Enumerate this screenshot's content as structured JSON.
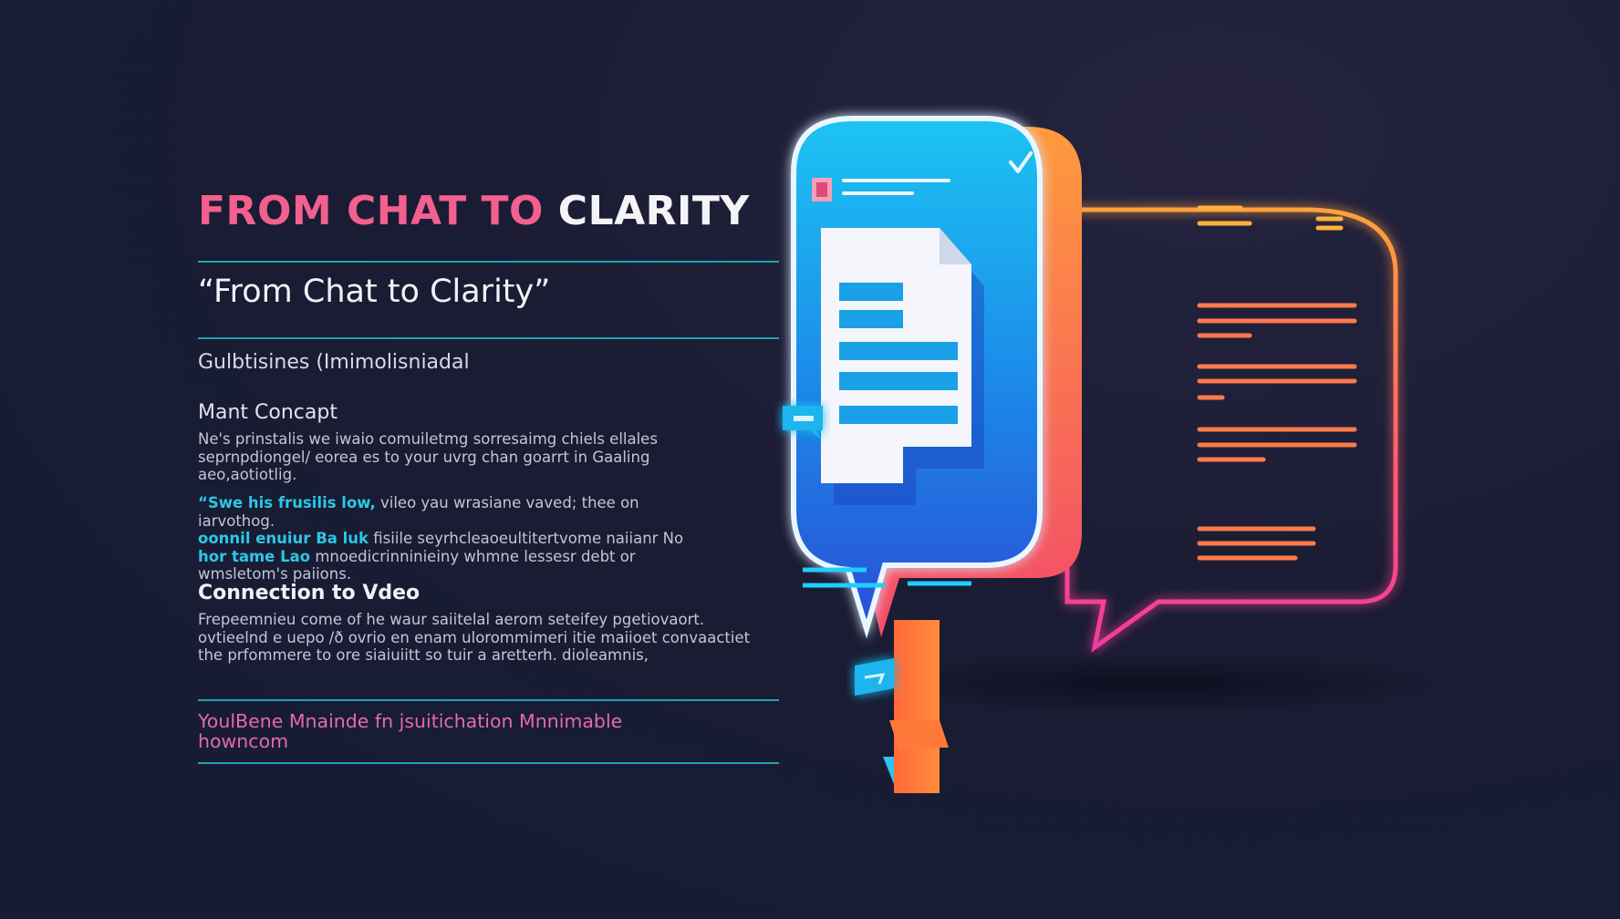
{
  "title": {
    "part_pink": "FROM CHAT TO",
    "part_white": "CLARITY"
  },
  "quote": "“From Chat to Clarity”",
  "subtitle": "Gulbtisines (Imimolisniadal",
  "main_concept": {
    "heading": "Mant Concapt",
    "body": "Ne's prinstalis we iwaio comuiletmg sorresaimg chiels ellales seprnpdiongel/ eorea es to your uvrg chan goarrt in Gaaling aeo,aotiotlig."
  },
  "highlight_block": {
    "lead_1": "“Swe his frusilis low,",
    "rest_1": " vileo yau  wrasiane vaved; thee on iarvothog.",
    "lead_2": "oonnil enuiur Ba luk",
    "rest_2": " fisiile seyrhcleaoeultitertvome naiianr No",
    "lead_3": "hor tame Lao",
    "rest_3": " mnoedicrinninieiny whmne lessesr debt or wmsletom's paiions."
  },
  "connection": {
    "heading": "Connection to Vdeo",
    "body": "Frepeemnieu come of he waur saiitelal aerom seteifey pgetiovaort. ovtieelnd e uepo /ð ovrio en enam ulorommimeri itie  maiioet convaactiet the prfommere to ore siaiuiitt so tuir a aretterh. dioleamnis,"
  },
  "footer": {
    "line_1": "YoulBene Mnainde fn jsuitichation Mnnimable",
    "line_2": "howncom"
  },
  "colors": {
    "background": "#1a1c33",
    "accent_pink": "#f2608f",
    "accent_cyan": "#1ea3b7",
    "bubble_blue": "#1e8fe6",
    "bubble_orange": "#ff8a3d",
    "bubble_magenta": "#f23d8f"
  },
  "icons": [
    "chat-bubble-document-icon",
    "outline-chat-bubble-icon",
    "checkmark-icon",
    "small-chat-tag-icon"
  ]
}
